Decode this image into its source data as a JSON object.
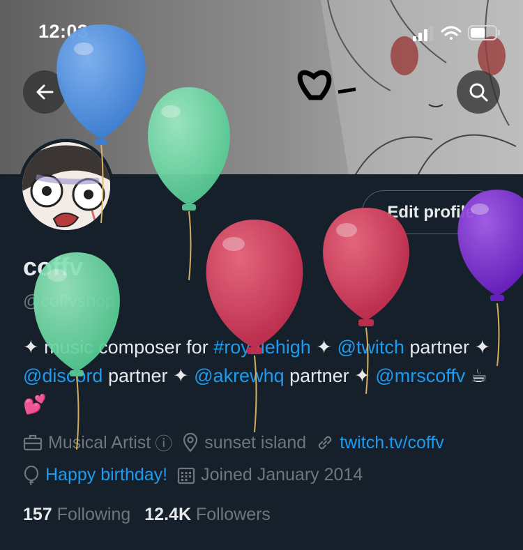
{
  "status_bar": {
    "time": "12:03",
    "battery_level": 0.6
  },
  "profile": {
    "display_name": "coffv",
    "handle": "@coffvshop",
    "edit_button": "Edit profile",
    "bio": {
      "p1": "✦ music composer for ",
      "l1": "#royalehigh",
      "p2": " ✦ ",
      "l2": "@twitch",
      "p3": " partner ✦ ",
      "l3": "@discord",
      "p4": " partner ✦ ",
      "l4": "@akrewhq",
      "p5": " partner ✦ ",
      "l5": "@mrscoffv",
      "p6": " ☕ 💕"
    },
    "category": "Musical Artist",
    "info_icon": "ⓘ",
    "location": "sunset island",
    "website": "twitch.tv/coffv",
    "birthday": "Happy birthday!",
    "joined": "Joined January 2014",
    "following_count": "157",
    "following_label": "Following",
    "followers_count": "12.4K",
    "followers_label": "Followers"
  },
  "icons": {
    "back": "back-arrow-icon",
    "search": "search-icon",
    "category": "briefcase-icon",
    "location": "location-pin-icon",
    "website": "link-icon",
    "birthday": "balloon-icon",
    "joined": "calendar-icon"
  },
  "colors": {
    "background": "#15202b",
    "link": "#1d9bf0",
    "secondary_text": "#71767b",
    "primary_text": "#e7e9ea",
    "balloon_blue": "#4f8fe0",
    "balloon_green": "#6fd8a4",
    "balloon_red": "#d63a5a",
    "balloon_purple": "#7a2ad0"
  }
}
